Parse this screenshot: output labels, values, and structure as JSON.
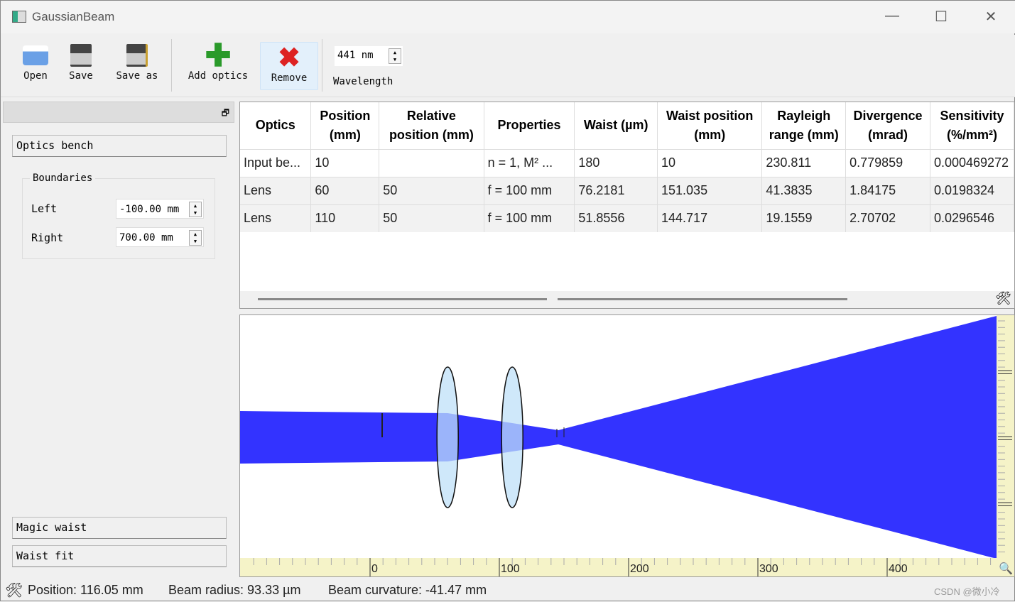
{
  "window": {
    "title": "GaussianBeam",
    "minimize": "—",
    "maximize": "☐",
    "close": "✕"
  },
  "toolbar": {
    "open": "Open",
    "save": "Save",
    "save_as": "Save as",
    "add_optics": "Add optics",
    "remove": "Remove",
    "wavelength_value": "441 nm",
    "wavelength_label": "Wavelength"
  },
  "left_panel": {
    "optics_bench": "Optics bench",
    "boundaries": "Boundaries",
    "left_label": "Left",
    "left_value": "-100.00 mm",
    "right_label": "Right",
    "right_value": "700.00 mm",
    "magic_waist": "Magic waist",
    "waist_fit": "Waist fit"
  },
  "table": {
    "headers": [
      "Optics",
      "Position (mm)",
      "Relative position (mm)",
      "Properties",
      "Waist (µm)",
      "Waist position (mm)",
      "Rayleigh range (mm)",
      "Divergence (mrad)",
      "Sensitivity (%/mm²)"
    ],
    "rows": [
      [
        "Input be...",
        "10",
        "",
        "n = 1, M² ...",
        "180",
        "10",
        "230.811",
        "0.779859",
        "0.000469272"
      ],
      [
        "Lens",
        "60",
        "50",
        "f = 100 mm",
        "76.2181",
        "151.035",
        "41.3835",
        "1.84175",
        "0.0198324"
      ],
      [
        "Lens",
        "110",
        "50",
        "f = 100 mm",
        "51.8556",
        "144.717",
        "19.1559",
        "2.70702",
        "0.0296546"
      ]
    ]
  },
  "plot": {
    "x_ticks": [
      "0",
      "100",
      "200",
      "300",
      "400"
    ],
    "lens_positions_mm": [
      60,
      110
    ],
    "beam_color": "#3333ff",
    "lens_color": "#bfe0f8"
  },
  "status": {
    "position": "Position: 116.05 mm",
    "beam_radius": "Beam radius: 93.33 µm",
    "beam_curvature": "Beam curvature: -41.47 mm",
    "watermark": "CSDN @微小冷"
  }
}
